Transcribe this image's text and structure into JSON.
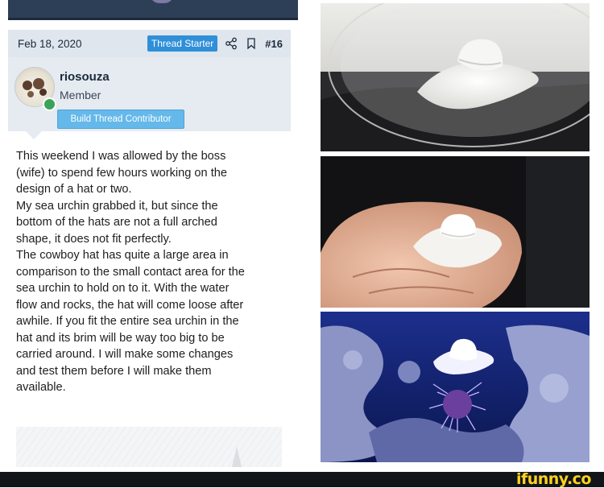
{
  "post": {
    "date": "Feb 18, 2020",
    "thread_starter_label": "Thread Starter",
    "post_number": "#16",
    "share_icon": "share-icon",
    "bookmark_icon": "bookmark-icon"
  },
  "user": {
    "name": "riosouza",
    "title": "Member",
    "badge": "Build Thread Contributor",
    "online": true
  },
  "body_lines": [
    "This weekend I was allowed by the boss",
    "(wife) to spend few hours working on the",
    "design of a hat or two.",
    "My sea urchin grabbed it, but since the",
    "bottom of the hats are not a full arched",
    "shape, it does not fit perfectly.",
    "The cowboy hat has quite a large area in",
    "comparison to the small contact area for the",
    "sea urchin to hold on to it. With the water",
    "flow and rocks, the hat will come loose after",
    "awhile. If you fit the entire sea urchin in the",
    "hat and its brim will be way too big to be",
    "carried around. I will make some changes",
    "and test them before I will make them",
    "available."
  ],
  "watermark": "ifunny.co",
  "colors": {
    "header_bg": "#dfe6ee",
    "badge_blue": "#2f8fd8",
    "contributor_badge": "#65b8ea",
    "online_green": "#3aa35a",
    "logo_yellow": "#ffd21f"
  }
}
